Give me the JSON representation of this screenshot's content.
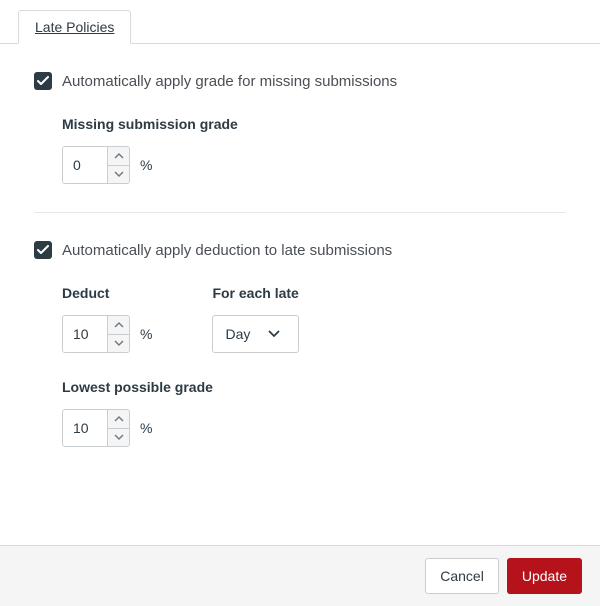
{
  "tabs": {
    "late_policies": "Late Policies"
  },
  "missing": {
    "checkbox_label": "Automatically apply grade for missing submissions",
    "grade_label": "Missing submission grade",
    "grade_value": "0",
    "grade_suffix": "%"
  },
  "late": {
    "checkbox_label": "Automatically apply deduction to late submissions",
    "deduct_label": "Deduct",
    "deduct_value": "10",
    "deduct_suffix": "%",
    "interval_label": "For each late",
    "interval_value": "Day",
    "lowest_label": "Lowest possible grade",
    "lowest_value": "10",
    "lowest_suffix": "%"
  },
  "footer": {
    "cancel": "Cancel",
    "update": "Update"
  },
  "colors": {
    "primary": "#b5121b"
  }
}
